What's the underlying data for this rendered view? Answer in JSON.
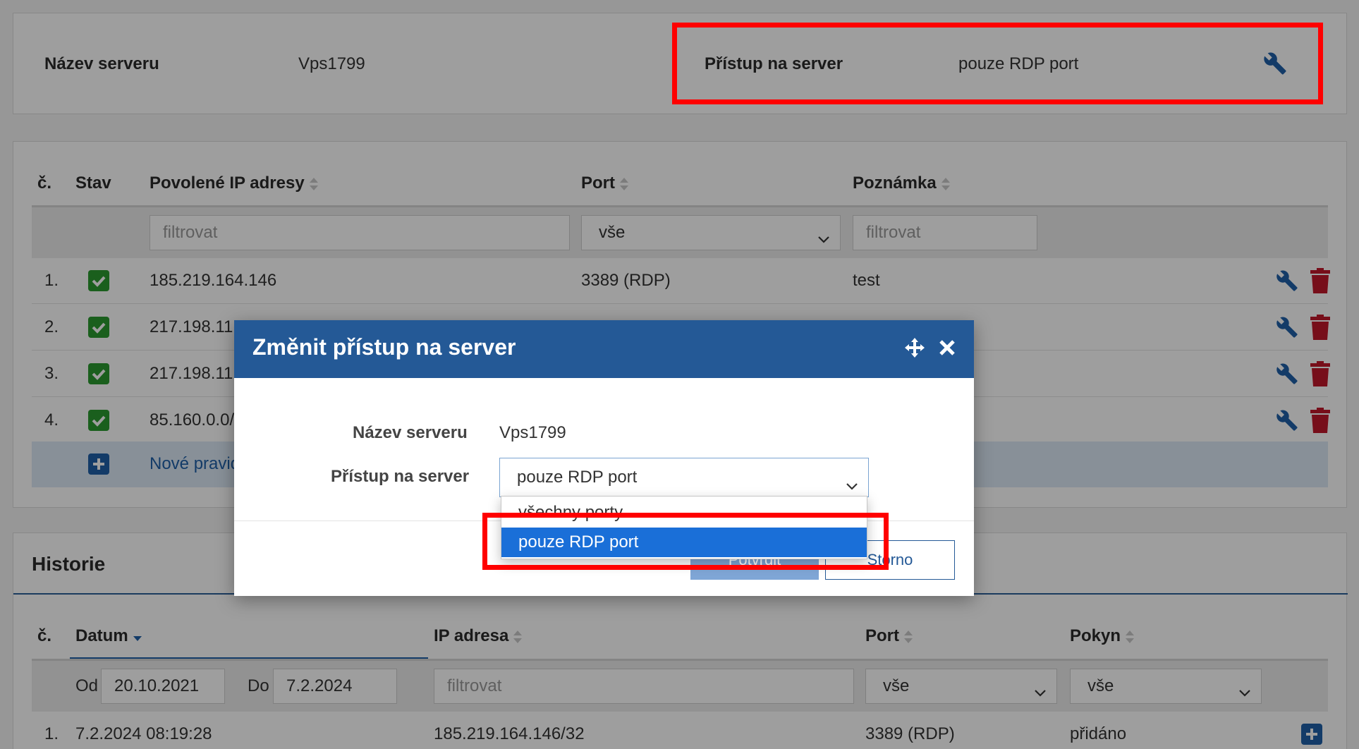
{
  "server_info": {
    "name_label": "Název serveru",
    "name_value": "Vps1799",
    "access_label": "Přístup na server",
    "access_value": "pouze RDP port"
  },
  "rules_table": {
    "columns": {
      "number": "č.",
      "status": "Stav",
      "ip": "Povolené IP adresy",
      "port": "Port",
      "note": "Poznámka"
    },
    "filters": {
      "ip_placeholder": "filtrovat",
      "port_selected": "vše",
      "note_placeholder": "filtrovat"
    },
    "rows": [
      {
        "num": "1.",
        "ip": "185.219.164.146",
        "port": "3389 (RDP)",
        "note": "test"
      },
      {
        "num": "2.",
        "ip": "217.198.11",
        "port": "",
        "note": ""
      },
      {
        "num": "3.",
        "ip": "217.198.11",
        "port": "",
        "note": ""
      },
      {
        "num": "4.",
        "ip": "85.160.0.0/",
        "port": "",
        "note": ""
      }
    ],
    "new_rule_label": "Nové pravid"
  },
  "history": {
    "title": "Historie",
    "columns": {
      "number": "č.",
      "date": "Datum",
      "ip": "IP adresa",
      "port": "Port",
      "command": "Pokyn"
    },
    "filters": {
      "from_label": "Od",
      "from_value": "20.10.2021",
      "to_label": "Do",
      "to_value": "7.2.2024",
      "ip_placeholder": "filtrovat",
      "port_selected": "vše",
      "command_selected": "vše"
    },
    "rows": [
      {
        "num": "1.",
        "date": "7.2.2024 08:19:28",
        "ip": "185.219.164.146/32",
        "port": "3389 (RDP)",
        "command": "přidáno"
      }
    ]
  },
  "dialog": {
    "title": "Změnit přístup na server",
    "name_label": "Název serveru",
    "name_value": "Vps1799",
    "access_label": "Přístup na server",
    "access_selected": "pouze RDP port",
    "options": [
      "všechny porty",
      "pouze RDP port"
    ],
    "confirm_label": "Potvrdit",
    "cancel_label": "Storno"
  },
  "colors": {
    "header_blue": "#245996",
    "check_green": "#2a9a2f",
    "trash_red": "#c0182b",
    "highlight_red": "#ff0000",
    "selected_option": "#1a6fd8"
  }
}
